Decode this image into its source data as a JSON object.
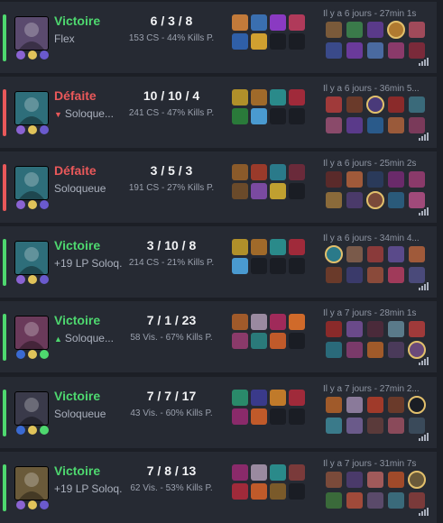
{
  "labels": {
    "victory_color": "#4ed86f",
    "defeat_color": "#e9585a",
    "expand_icon": "signal-bars-icon"
  },
  "matches": [
    {
      "result": "Victoire",
      "queue": "Flex",
      "lp": "",
      "kda": "6 / 3 / 8",
      "stats": "153 CS - 44% Kills P.",
      "time": "Il y a 6 jours - 27min 1s",
      "avatar_color": "#5a4a6e",
      "runes": [
        "#8a63d2",
        "#e0c35a",
        "#6a5acd"
      ],
      "items": [
        "#c27a3a",
        "#3a6fb0",
        "#8a3ac2",
        "#b03a5a",
        "#2f5fa8",
        "#d0a030",
        "",
        ""
      ],
      "champs": [
        "#7a5a3a",
        "#3a7a4a",
        "#5a3a8a",
        "#b07a30",
        "#a04a5a",
        "#3a4a8a",
        "#6a3a9a",
        "#4a6aa0",
        "#8a3a6a",
        "#7a2a3a"
      ],
      "self_index": 3
    },
    {
      "result": "Défaite",
      "queue": "Soloque...",
      "lp": "",
      "kda": "10 / 10 / 4",
      "stats": "241 CS - 47% Kills P.",
      "time": "Il y a 6 jours - 36min 5...",
      "avatar_color": "#2e6e7a",
      "runes": [
        "#8a63d2",
        "#e0c35a",
        "#6a5acd"
      ],
      "items": [
        "#b0902a",
        "#a06a2a",
        "#2a8a8a",
        "#a02a3a",
        "#2a7a3a",
        "#4a9ad0",
        "",
        ""
      ],
      "champs": [
        "#a03a3a",
        "#6a3a2a",
        "#4a3a7a",
        "#8a2a2a",
        "#3a6a7a",
        "#8a4a6a",
        "#5a3a8a",
        "#2a5a8a",
        "#9a5a3a",
        "#7a3a5a"
      ],
      "self_index": 2
    },
    {
      "result": "Défaite",
      "queue": "Soloqueue",
      "lp": "",
      "kda": "3 / 5 / 3",
      "stats": "191 CS - 27% Kills P.",
      "time": "Il y a 6 jours - 25min 2s",
      "avatar_color": "#2e6e7a",
      "runes": [
        "#8a63d2",
        "#e0c35a",
        "#6a5acd"
      ],
      "items": [
        "#8a5a2a",
        "#9a3a2a",
        "#2a7a8a",
        "#6a2a3a",
        "#6a4a2a",
        "#7a4aa0",
        "#c0a030",
        ""
      ],
      "champs": [
        "#5a2a2a",
        "#a05a3a",
        "#2a3a5a",
        "#6a2a6a",
        "#8a3a6a",
        "#8a6a3a",
        "#4a3a6a",
        "#7a4a3a",
        "#2a5a7a",
        "#a04a7a"
      ],
      "self_index": 7
    },
    {
      "result": "Victoire",
      "queue": "Soloq...",
      "lp": "+19 LP",
      "kda": "3 / 10 / 8",
      "stats": "214 CS - 21% Kills P.",
      "time": "Il y a 6 jours - 34min 4...",
      "avatar_color": "#2e6e7a",
      "runes": [
        "#8a63d2",
        "#e0c35a",
        "#6a5acd"
      ],
      "items": [
        "#b0902a",
        "#a06a2a",
        "#2a8a8a",
        "#a02a3a",
        "#4a9ad0",
        "#1a1d24",
        "",
        ""
      ],
      "champs": [
        "#2a7a8a",
        "#7a5a4a",
        "#8a3a3a",
        "#5a4a8a",
        "#a05a3a",
        "#6a3a2a",
        "#3a3a6a",
        "#8a4a3a",
        "#a03a5a",
        "#4a4a7a"
      ],
      "self_index": 0
    },
    {
      "result": "Victoire",
      "queue": "Soloque...",
      "lp": "",
      "kda": "7 / 1 / 23",
      "stats": "58 Vis. - 67% Kills P.",
      "time": "Il y a 7 jours - 28min 1s",
      "avatar_color": "#6a3a5a",
      "runes": [
        "#3a6ad2",
        "#e0c35a",
        "#4ed86f"
      ],
      "items": [
        "#a05a2a",
        "#9a8aa0",
        "#a02a5a",
        "#d06a2a",
        "#8a3a6a",
        "#2a7a7a",
        "#c05a2a",
        ""
      ],
      "champs": [
        "#8a2a2a",
        "#6a4a8a",
        "#4a2a3a",
        "#5a7a8a",
        "#a03a3a",
        "#2a6a7a",
        "#7a3a6a",
        "#a05a2a",
        "#4a3a5a",
        "#6a4a7a"
      ],
      "self_index": 9
    },
    {
      "result": "Victoire",
      "queue": "Soloqueue",
      "lp": "",
      "kda": "7 / 7 / 17",
      "stats": "43 Vis. - 60% Kills P.",
      "time": "Il y a 7 jours - 27min 2...",
      "avatar_color": "#3a3a4a",
      "runes": [
        "#3a6ad2",
        "#e0c35a",
        "#4ed86f"
      ],
      "items": [
        "#2a8a6a",
        "#3a3a8a",
        "#c07a2a",
        "#a02a3a",
        "#8a2a6a",
        "#c05a2a",
        "",
        ""
      ],
      "champs": [
        "#a05a2a",
        "#8a7a9a",
        "#a03a2a",
        "#6a3a2a",
        "#1a1d24",
        "#3a7a8a",
        "#6a5a8a",
        "#5a3a3a",
        "#8a4a5a",
        "#3a4a5a"
      ],
      "self_index": 4
    },
    {
      "result": "Victoire",
      "queue": "Soloq...",
      "lp": "+19 LP",
      "kda": "7 / 8 / 13",
      "stats": "62 Vis. - 53% Kills P.",
      "time": "Il y a 7 jours - 31min 7s",
      "avatar_color": "#6a5a3a",
      "runes": [
        "#8a63d2",
        "#e0c35a",
        "#6a5acd"
      ],
      "items": [
        "#8a2a6a",
        "#9a8aa0",
        "#2a8a8a",
        "#7a3a3a",
        "#a02a3a",
        "#c05a2a",
        "#7a5a2a",
        ""
      ],
      "champs": [
        "#7a4a3a",
        "#4a3a6a",
        "#a05a5a",
        "#a04a2a",
        "#6a5a3a",
        "#3a6a3a",
        "#a04a3a",
        "#5a4a6a",
        "#3a6a7a",
        "#7a3a3a"
      ],
      "self_index": 4
    }
  ]
}
